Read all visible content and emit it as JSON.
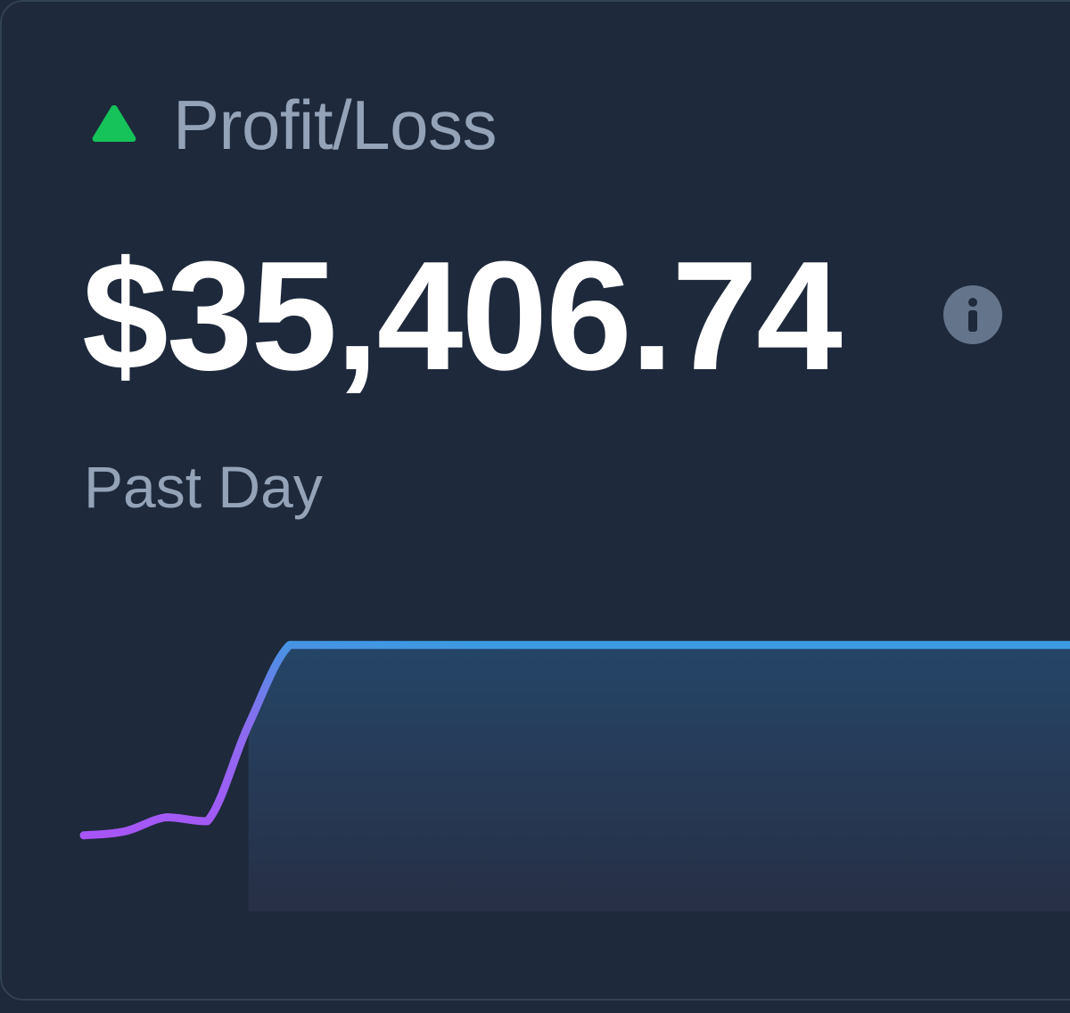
{
  "card": {
    "title": "Profit/Loss",
    "trend_icon": "triangle-up-icon",
    "value": "$35,406.74",
    "info_icon": "info-icon",
    "period": "Past Day"
  },
  "colors": {
    "background": "#1e293b",
    "label": "#94a3b8",
    "value": "#ffffff",
    "trend_up": "#16c25a",
    "line_start": "#a855f7",
    "line_end": "#3b9ae1"
  },
  "chart_data": {
    "type": "area",
    "x": [
      0,
      1,
      2,
      3,
      4,
      5,
      6,
      7,
      8,
      9,
      10,
      11,
      12,
      13,
      14,
      15,
      16,
      17,
      18,
      19,
      20,
      21,
      22,
      23,
      24
    ],
    "values": [
      5,
      7,
      14,
      12,
      60,
      100,
      100,
      100,
      100,
      100,
      100,
      100,
      100,
      100,
      100,
      100,
      100,
      100,
      100,
      100,
      100,
      100,
      100,
      100,
      100
    ],
    "ylim": [
      0,
      105
    ]
  }
}
